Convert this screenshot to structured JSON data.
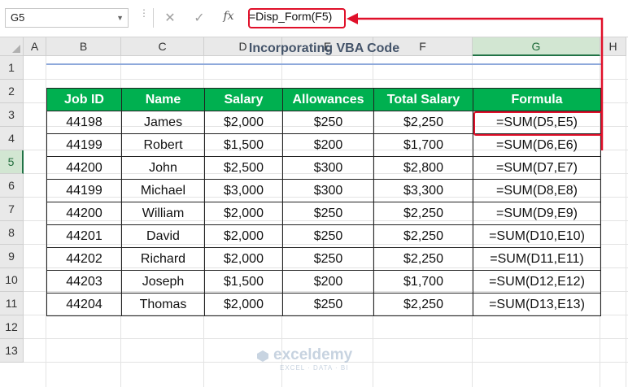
{
  "formula_bar": {
    "name_box": "G5",
    "cancel_glyph": "✕",
    "enter_glyph": "✓",
    "fx_label": "fx",
    "formula": "=Disp_Form(F5)"
  },
  "columns": [
    "A",
    "B",
    "C",
    "D",
    "E",
    "F",
    "G",
    "H"
  ],
  "selected_column": "G",
  "rows": [
    "1",
    "2",
    "3",
    "4",
    "5",
    "6",
    "7",
    "8",
    "9",
    "10",
    "11",
    "12",
    "13"
  ],
  "selected_row": "5",
  "sheet": {
    "title": "Incorporating VBA Code",
    "headers": [
      "Job ID",
      "Name",
      "Salary",
      "Allowances",
      "Total Salary",
      "Formula"
    ],
    "records": [
      [
        "44198",
        "James",
        "$2,000",
        "$250",
        "$2,250",
        "=SUM(D5,E5)"
      ],
      [
        "44199",
        "Robert",
        "$1,500",
        "$200",
        "$1,700",
        "=SUM(D6,E6)"
      ],
      [
        "44200",
        "John",
        "$2,500",
        "$300",
        "$2,800",
        "=SUM(D7,E7)"
      ],
      [
        "44199",
        "Michael",
        "$3,000",
        "$300",
        "$3,300",
        "=SUM(D8,E8)"
      ],
      [
        "44200",
        "William",
        "$2,000",
        "$250",
        "$2,250",
        "=SUM(D9,E9)"
      ],
      [
        "44201",
        "David",
        "$2,000",
        "$250",
        "$2,250",
        "=SUM(D10,E10)"
      ],
      [
        "44202",
        "Richard",
        "$2,000",
        "$250",
        "$2,250",
        "=SUM(D11,E11)"
      ],
      [
        "44203",
        "Joseph",
        "$1,500",
        "$200",
        "$1,700",
        "=SUM(D12,E12)"
      ],
      [
        "44204",
        "Thomas",
        "$2,000",
        "$250",
        "$2,250",
        "=SUM(D13,E13)"
      ]
    ]
  },
  "watermark": {
    "brand": "exceldemy",
    "tagline": "EXCEL · DATA · BI"
  },
  "colors": {
    "header_green": "#00b050",
    "highlight_red": "#e0102a",
    "title_color": "#44546a"
  }
}
